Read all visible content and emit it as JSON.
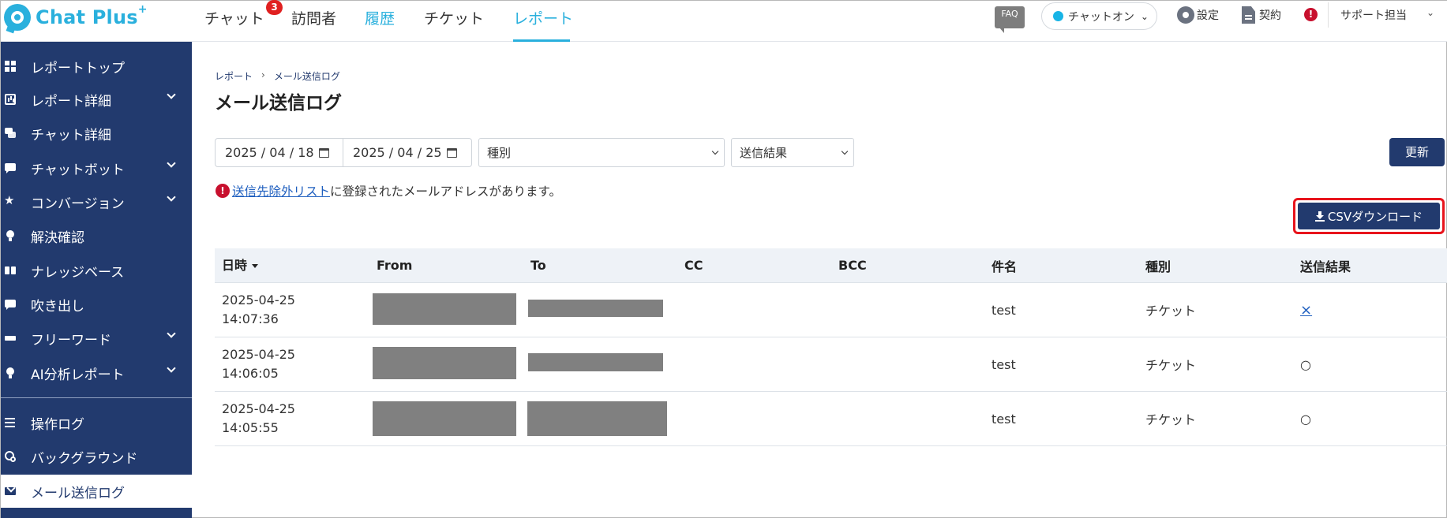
{
  "app": {
    "logo_text": "Chat Plus",
    "logo_sup": "+"
  },
  "nav": {
    "items": [
      {
        "label": "チャット",
        "badge": "3"
      },
      {
        "label": "訪問者"
      },
      {
        "label": "履歴"
      },
      {
        "label": "チケット"
      },
      {
        "label": "レポート",
        "active": true
      }
    ]
  },
  "topbar": {
    "faq": "FAQ",
    "status": "チャットオン",
    "settings": "設定",
    "contract": "契約",
    "alert": "!",
    "user": "サポート担当"
  },
  "sidebar": {
    "items": [
      {
        "label": "レポートトップ",
        "icon": "dashboard-icon"
      },
      {
        "label": "レポート詳細",
        "icon": "chart-icon",
        "expandable": true
      },
      {
        "label": "チャット詳細",
        "icon": "chat-bubbles-icon"
      },
      {
        "label": "チャットボット",
        "icon": "chat-bubble-icon",
        "expandable": true
      },
      {
        "label": "コンバージョン",
        "icon": "star-icon",
        "expandable": true
      },
      {
        "label": "解決確認",
        "icon": "lightbulb-icon"
      },
      {
        "label": "ナレッジベース",
        "icon": "book-icon"
      },
      {
        "label": "吹き出し",
        "icon": "speech-icon"
      },
      {
        "label": "フリーワード",
        "icon": "tag-icon",
        "expandable": true
      },
      {
        "label": "AI分析レポート",
        "icon": "lightbulb-icon",
        "expandable": true
      }
    ],
    "bottom_items": [
      {
        "label": "操作ログ",
        "icon": "list-icon"
      },
      {
        "label": "バックグラウンド",
        "icon": "gears-icon"
      },
      {
        "label": "メール送信ログ",
        "icon": "mail-icon",
        "active": true
      }
    ]
  },
  "main": {
    "breadcrumb": {
      "parent": "レポート",
      "sep": "›",
      "current": "メール送信ログ"
    },
    "title": "メール送信ログ",
    "filters": {
      "date_from": "2025 / 04 / 18",
      "date_to": "2025 / 04 / 25",
      "type_select": "種別",
      "result_select": "送信結果"
    },
    "refresh_label": "更新",
    "notice": {
      "icon": "!",
      "link": "送信先除外リスト",
      "text": "に登録されたメールアドレスがあります。"
    },
    "csv_label": "CSVダウンロード"
  },
  "table": {
    "headers": [
      "日時",
      "From",
      "To",
      "CC",
      "BCC",
      "件名",
      "種別",
      "送信結果"
    ],
    "rows": [
      {
        "date": "2025-04-25",
        "time": "14:07:36",
        "subject": "test",
        "type": "チケット",
        "result": "×"
      },
      {
        "date": "2025-04-25",
        "time": "14:06:05",
        "subject": "test",
        "type": "チケット",
        "result": "○"
      },
      {
        "date": "2025-04-25",
        "time": "14:05:55",
        "subject": "test",
        "type": "チケット",
        "result": "○"
      }
    ]
  },
  "colors": {
    "sidebar": "#223a6e",
    "accent": "#2ab0dd",
    "alert": "#c8102e",
    "highlight": "#e8141c"
  }
}
